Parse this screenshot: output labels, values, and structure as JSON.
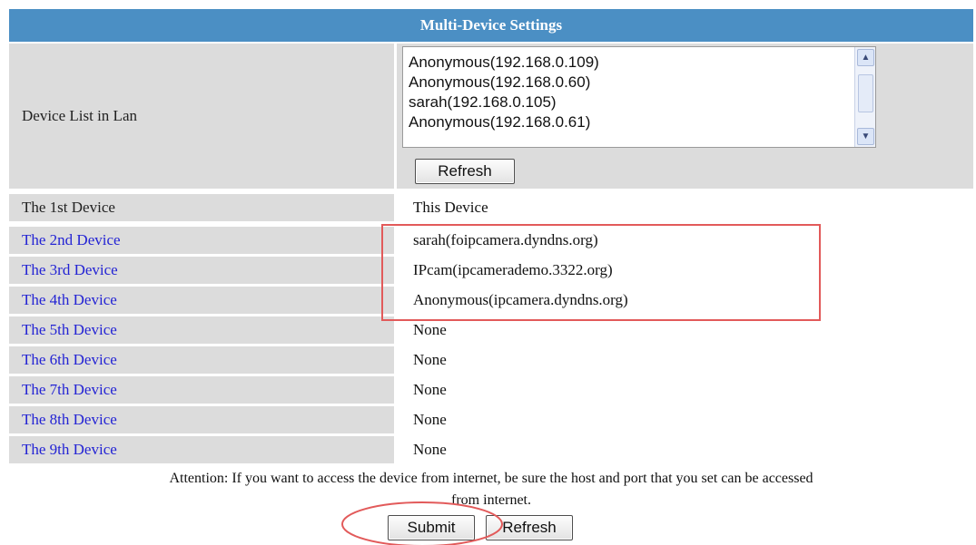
{
  "header": {
    "title": "Multi-Device Settings"
  },
  "device_list": {
    "label": "Device List in Lan",
    "items": [
      "Anonymous(192.168.0.109)",
      "Anonymous(192.168.0.60)",
      "sarah(192.168.0.105)",
      "Anonymous(192.168.0.61)"
    ],
    "refresh_label": "Refresh"
  },
  "devices": [
    {
      "label": "The 1st Device",
      "value": "This Device"
    },
    {
      "label": "The 2nd Device",
      "value": "sarah(foipcamera.dyndns.org)"
    },
    {
      "label": "The 3rd Device",
      "value": "IPcam(ipcamerademo.3322.org)"
    },
    {
      "label": "The 4th Device",
      "value": "Anonymous(ipcamera.dyndns.org)"
    },
    {
      "label": "The 5th Device",
      "value": "None"
    },
    {
      "label": "The 6th Device",
      "value": "None"
    },
    {
      "label": "The 7th Device",
      "value": "None"
    },
    {
      "label": "The 8th Device",
      "value": "None"
    },
    {
      "label": "The 9th Device",
      "value": "None"
    }
  ],
  "attention": {
    "line1": "Attention: If you want to access the device from internet, be sure the host and port that you set can be accessed",
    "line2": "from internet."
  },
  "footer": {
    "submit_label": "Submit",
    "refresh_label": "Refresh"
  },
  "colors": {
    "header_bg": "#4b8fc4",
    "row_bg": "#dcdcdc",
    "link": "#2323d4",
    "annotation": "#e25a5a"
  }
}
